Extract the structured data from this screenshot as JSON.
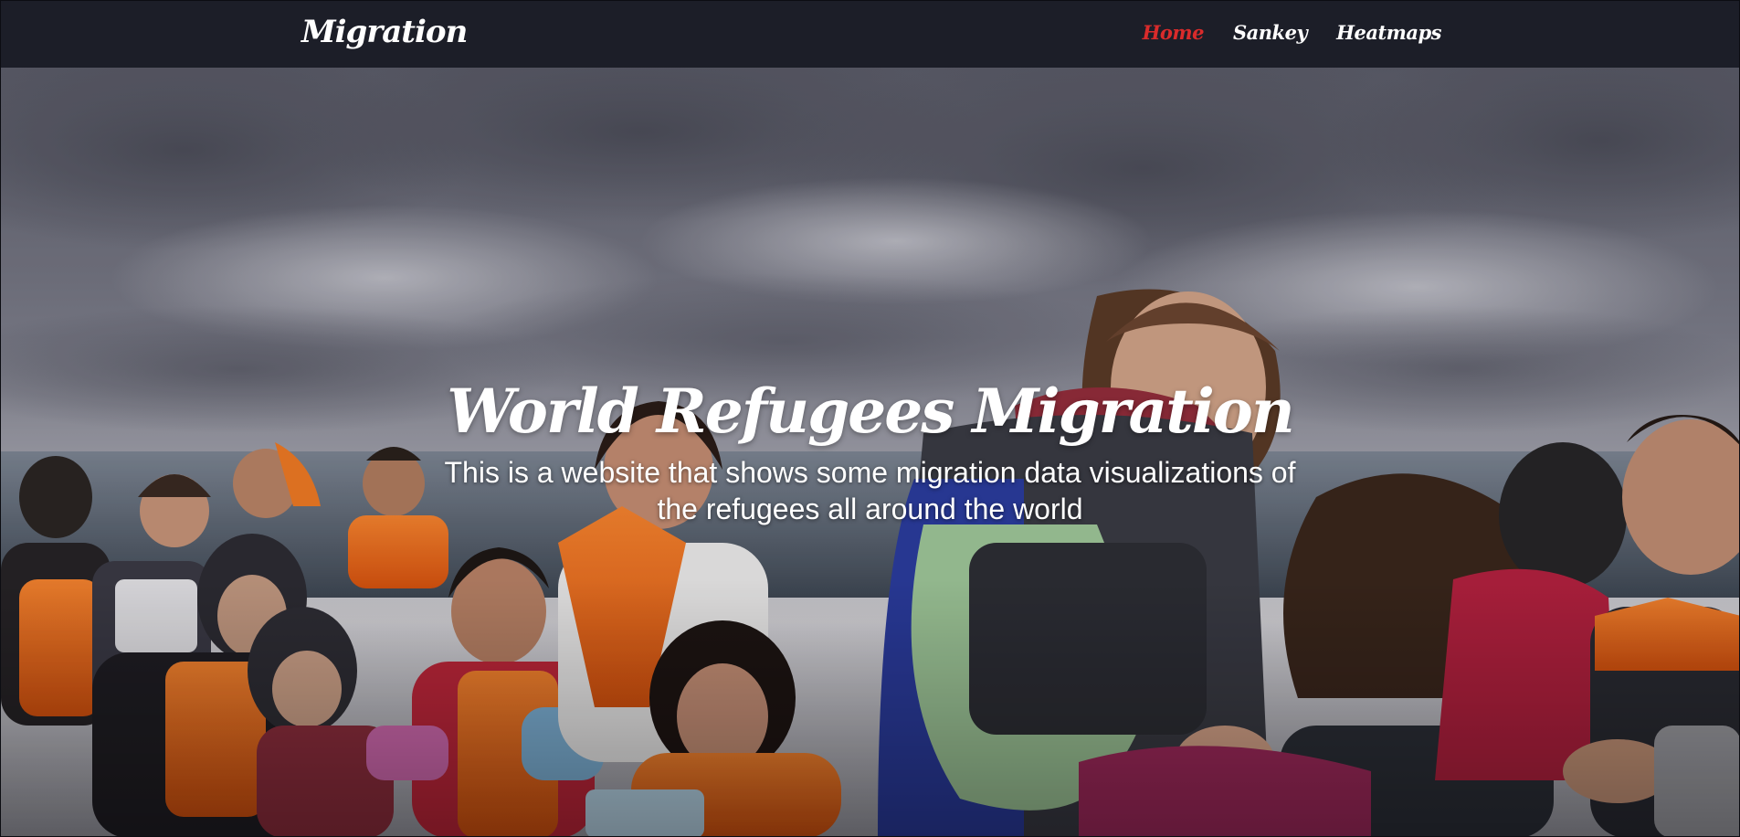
{
  "navbar": {
    "brand": "Migration",
    "links": [
      {
        "label": "Home",
        "active": true
      },
      {
        "label": "Sankey",
        "active": false
      },
      {
        "label": "Heatmaps",
        "active": false
      }
    ]
  },
  "hero": {
    "title": "World Refugees Migration",
    "subtitle": "This is a website that shows some migration data visualizations of the refugees all around the world",
    "image_subject": "refugees-in-boat-photo"
  },
  "colors": {
    "navbar_bg": "#1c1e28",
    "active_link": "#d92b2b",
    "text": "#ffffff",
    "life_vest": "#f26b1d"
  }
}
